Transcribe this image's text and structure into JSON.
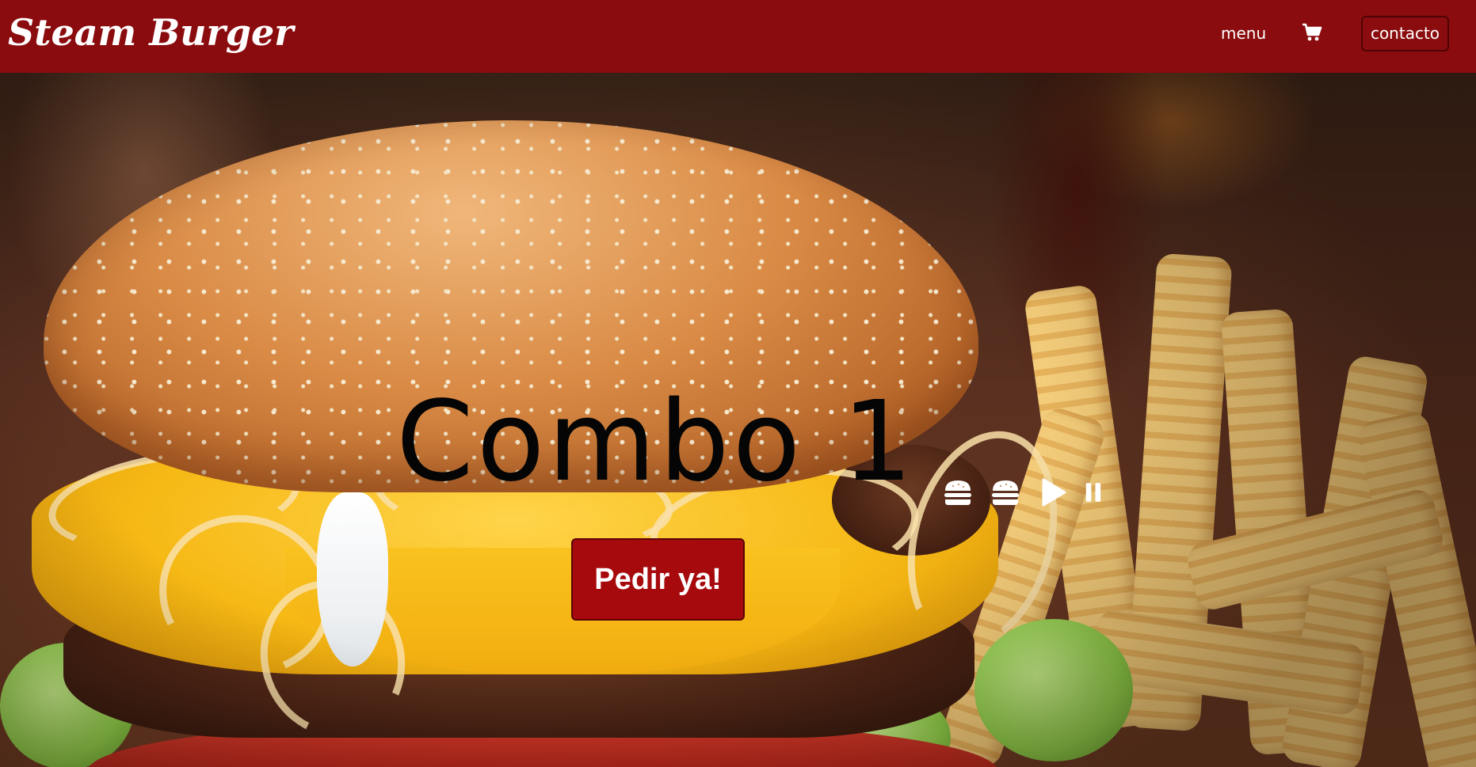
{
  "header": {
    "brand": "Steam Burger",
    "nav": {
      "menu_label": "menu",
      "cart_icon": "cart-icon",
      "contact_label": "contacto"
    }
  },
  "hero": {
    "title": "Combo 1",
    "order_button_label": "Pedir ya!",
    "controls": [
      {
        "icon": "burger-icon"
      },
      {
        "icon": "burger-icon"
      },
      {
        "icon": "play-icon"
      },
      {
        "icon": "pause-icon"
      }
    ]
  },
  "colors": {
    "navbar": "#8b0c0e",
    "button": "#a70a0d",
    "text_light": "#ffffff",
    "title": "#050505"
  }
}
